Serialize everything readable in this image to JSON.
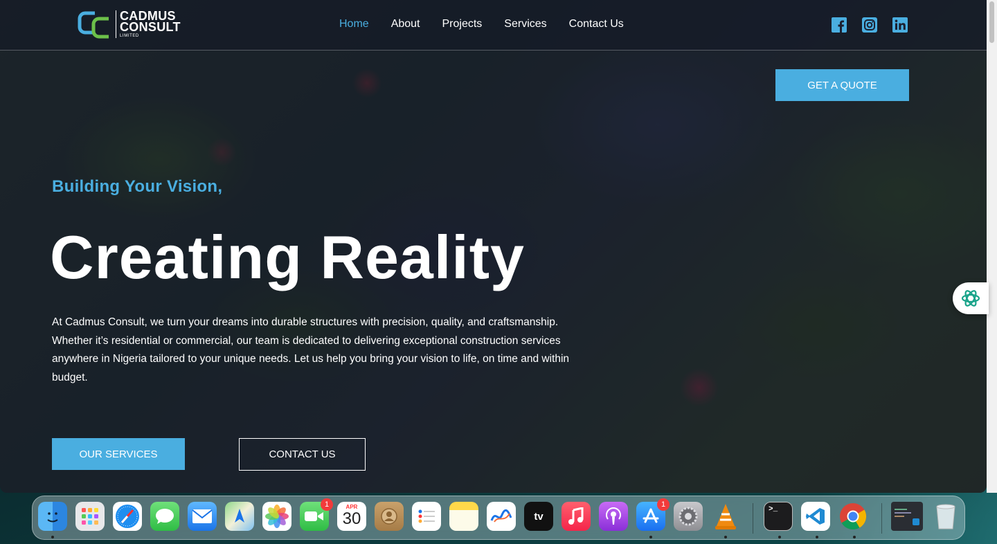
{
  "logo": {
    "line1": "CADMUS",
    "line2": "CONSULT",
    "line3": "LIMITED"
  },
  "nav": {
    "items": [
      "Home",
      "About",
      "Projects",
      "Services",
      "Contact Us"
    ],
    "active": "Home"
  },
  "social": [
    "facebook-icon",
    "instagram-icon",
    "linkedin-icon"
  ],
  "header": {
    "quote_button": "GET A QUOTE"
  },
  "hero": {
    "kicker": "Building Your Vision,",
    "headline": "Creating Reality",
    "description": "At Cadmus Consult, we turn your dreams into durable structures with precision, quality, and craftsmanship. Whether it’s residential or commercial, our team is dedicated to delivering exceptional construction services anywhere in Nigeria tailored to your unique needs. Let us help you bring your vision to life, on time and within budget.",
    "primary_button": "OUR SERVICES",
    "secondary_button": "CONTACT US"
  },
  "colors": {
    "accent": "#4aaee0",
    "logo_green": "#6cc04a",
    "overlay": "#141626"
  },
  "dock": {
    "items": [
      {
        "name": "Finder",
        "icon": "finder-icon"
      },
      {
        "name": "Launchpad",
        "icon": "launchpad-icon"
      },
      {
        "name": "Safari",
        "icon": "safari-icon"
      },
      {
        "name": "Messages",
        "icon": "messages-icon"
      },
      {
        "name": "Mail",
        "icon": "mail-icon"
      },
      {
        "name": "Maps",
        "icon": "maps-icon"
      },
      {
        "name": "Photos",
        "icon": "photos-icon"
      },
      {
        "name": "FaceTime",
        "icon": "facetime-icon",
        "badge": "1"
      },
      {
        "name": "Calendar",
        "icon": "calendar-icon",
        "month": "APR",
        "day": "30"
      },
      {
        "name": "Contacts",
        "icon": "contacts-icon"
      },
      {
        "name": "Reminders",
        "icon": "reminders-icon"
      },
      {
        "name": "Notes",
        "icon": "notes-icon"
      },
      {
        "name": "Freeform",
        "icon": "freeform-icon"
      },
      {
        "name": "TV",
        "icon": "tv-icon",
        "label": "tv"
      },
      {
        "name": "Music",
        "icon": "music-icon"
      },
      {
        "name": "Podcasts",
        "icon": "podcasts-icon"
      },
      {
        "name": "App Store",
        "icon": "app-store-icon",
        "badge": "1"
      },
      {
        "name": "System Settings",
        "icon": "settings-icon"
      },
      {
        "name": "VLC",
        "icon": "vlc-icon"
      },
      {
        "name": "Terminal",
        "icon": "terminal-icon",
        "label": ">_"
      },
      {
        "name": "Visual Studio Code",
        "icon": "vscode-icon"
      },
      {
        "name": "Chrome",
        "icon": "chrome-icon"
      },
      {
        "name": "Recent Window",
        "icon": "window-thumbnail-icon"
      },
      {
        "name": "Trash",
        "icon": "trash-icon"
      }
    ]
  }
}
